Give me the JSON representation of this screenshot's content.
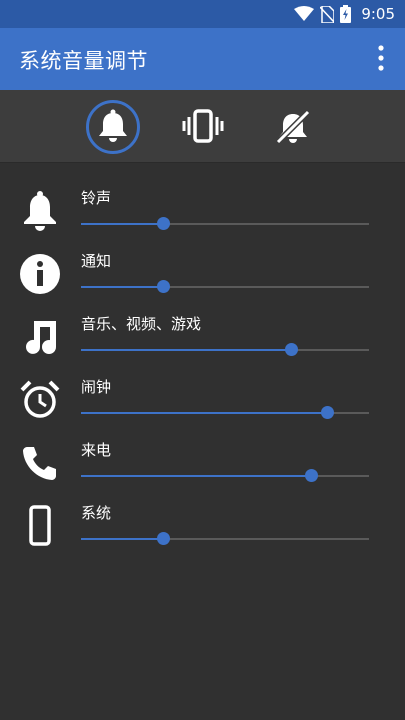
{
  "status_bar": {
    "time": "9:05"
  },
  "app_bar": {
    "title": "系统音量调节"
  },
  "modes": [
    {
      "name": "sound",
      "active": true
    },
    {
      "name": "vibrate",
      "active": false
    },
    {
      "name": "silent",
      "active": false
    }
  ],
  "volumes": [
    {
      "label": "铃声",
      "icon": "bell-icon",
      "level": 0.285
    },
    {
      "label": "通知",
      "icon": "info-icon",
      "level": 0.285
    },
    {
      "label": "音乐、视频、游戏",
      "icon": "music-note-icon",
      "level": 0.73
    },
    {
      "label": "闹钟",
      "icon": "alarm-clock-icon",
      "level": 0.855
    },
    {
      "label": "来电",
      "icon": "phone-icon",
      "level": 0.8
    },
    {
      "label": "系统",
      "icon": "smartphone-icon",
      "level": 0.285
    }
  ],
  "colors": {
    "accent": "#3d72c8",
    "status_bar": "#2c5aa6",
    "background": "#303030",
    "mode_bar": "#3d3d3d"
  }
}
